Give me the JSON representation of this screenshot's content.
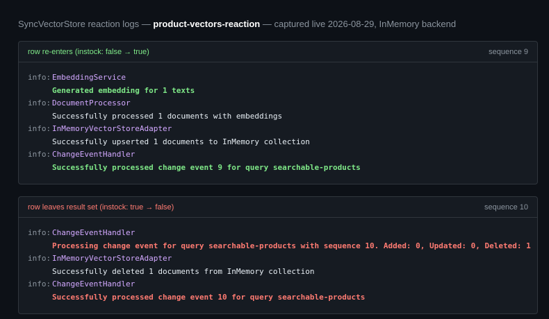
{
  "header": {
    "prefix": "SyncVectorStore reaction logs — ",
    "reaction_name": "product-vectors-reaction",
    "suffix": " — captured live 2026-08-29, InMemory backend"
  },
  "panels": [
    {
      "title": "row re-enters (instock: false → true)",
      "sequence": "sequence 9",
      "title_color": "#7ee787",
      "entries": [
        {
          "level": "info:",
          "source": "EmbeddingService",
          "message": "Generated embedding for 1 texts",
          "highlight": "green"
        },
        {
          "level": "info:",
          "source": "DocumentProcessor",
          "message": "Successfully processed 1 documents with embeddings",
          "highlight": "none"
        },
        {
          "level": "info:",
          "source": "InMemoryVectorStoreAdapter",
          "message": "Successfully upserted 1 documents to InMemory collection",
          "highlight": "none"
        },
        {
          "level": "info:",
          "source": "ChangeEventHandler",
          "message": "Successfully processed change event 9 for query searchable-products",
          "highlight": "green"
        }
      ]
    },
    {
      "title": "row leaves result set (instock: true → false)",
      "sequence": "sequence 10",
      "title_color": "#ff7b72",
      "entries": [
        {
          "level": "info:",
          "source": "ChangeEventHandler",
          "message": "Processing change event for query searchable-products with sequence 10. Added: 0, Updated: 0, Deleted: 1",
          "highlight": "red"
        },
        {
          "level": "info:",
          "source": "InMemoryVectorStoreAdapter",
          "message": "Successfully deleted 1 documents from InMemory collection",
          "highlight": "none"
        },
        {
          "level": "info:",
          "source": "ChangeEventHandler",
          "message": "Successfully processed change event 10 for query searchable-products",
          "highlight": "red"
        }
      ]
    }
  ]
}
